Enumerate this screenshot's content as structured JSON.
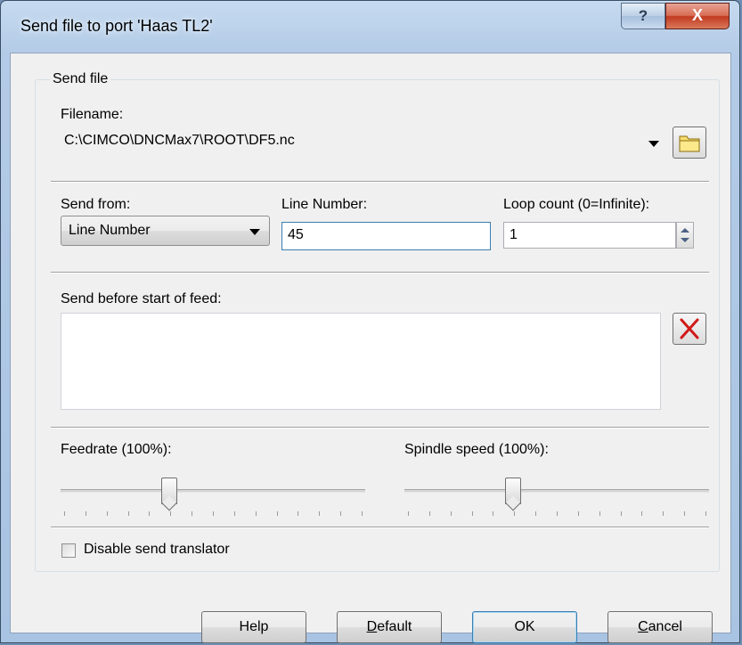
{
  "window": {
    "title": "Send file to port 'Haas TL2'",
    "help_button": "?",
    "close_button": "X"
  },
  "group": {
    "legend": "Send file"
  },
  "filename": {
    "label": "Filename:",
    "value": "C:\\CIMCO\\DNCMax7\\ROOT\\DF5.nc",
    "browse_icon": "folder-icon"
  },
  "send_from": {
    "label": "Send from:",
    "selected": "Line Number"
  },
  "line_number": {
    "label": "Line Number:",
    "value": "45"
  },
  "loop_count": {
    "label": "Loop count (0=Infinite):",
    "value": "1"
  },
  "before_feed": {
    "label": "Send before start of feed:",
    "value": "",
    "clear_icon": "red-x-icon"
  },
  "feedrate": {
    "label": "Feedrate (100%):",
    "level": 0.35
  },
  "spindle": {
    "label": "Spindle speed (100%):",
    "level": 0.35
  },
  "translator": {
    "label": "Disable send translator",
    "checked": false
  },
  "buttons": {
    "help": "Help",
    "default_first": "D",
    "default_rest": "efault",
    "ok": "OK",
    "cancel_first": "C",
    "cancel_rest": "ancel"
  },
  "colors": {
    "title_bar": "#b3cbe6",
    "close_button": "#c1391f",
    "dialog_bg": "#f0f0f0",
    "focus_border": "#3c7fb1"
  }
}
